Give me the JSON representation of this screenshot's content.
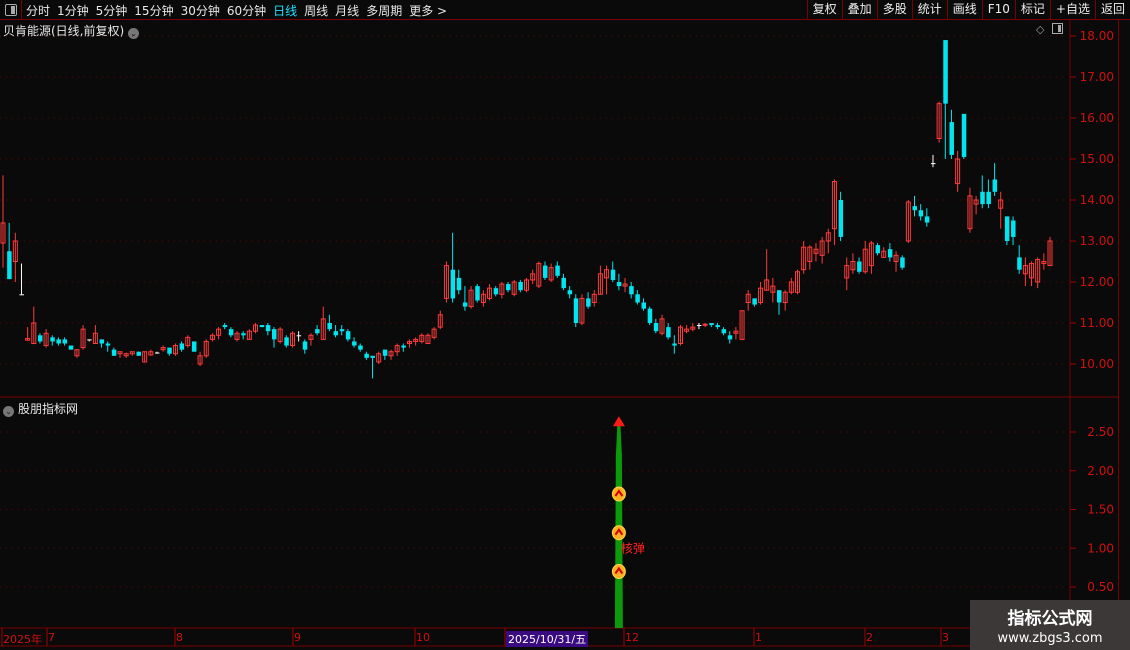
{
  "toolbar": {
    "periods": [
      "分时",
      "1分钟",
      "5分钟",
      "15分钟",
      "30分钟",
      "60分钟",
      "日线",
      "周线",
      "月线",
      "多周期",
      "更多 >"
    ],
    "active_period": "日线",
    "buttons": [
      "复权",
      "叠加",
      "多股",
      "统计",
      "画线",
      "F10",
      "标记",
      "+自选",
      "返回"
    ]
  },
  "main_panel": {
    "title": "贝肯能源(日线,前复权)",
    "y_ticks": [
      "18.00",
      "17.00",
      "16.00",
      "15.00",
      "14.00",
      "13.00",
      "12.00",
      "11.00",
      "10.00"
    ],
    "up_color": "#ff3b3b",
    "down_color": "#00e5f0",
    "flat_color": "#ffffff"
  },
  "indicator_panel": {
    "title": "股朋指标网",
    "y_ticks": [
      "2.50",
      "2.00",
      "1.50",
      "1.00",
      "0.50"
    ],
    "signal": {
      "bar": 101,
      "value": 2.6,
      "markers": [
        1.7,
        1.2,
        0.7
      ],
      "label": "核弹",
      "bar_color": "#0a9a0a",
      "arrow_color": "#ff1a1a"
    }
  },
  "time_axis": {
    "labels": [
      "2025年",
      "7",
      "8",
      "9",
      "10",
      "2025/10/31/五",
      "12",
      "1",
      "2",
      "3"
    ],
    "selected": "2025/10/31/五"
  },
  "watermark": {
    "name": "指标公式网",
    "url": "www.zbgs3.com"
  },
  "chart_data": {
    "type": "candlestick",
    "ylim": [
      9.6,
      18.0
    ],
    "indicator_ylim": [
      0,
      2.8
    ],
    "ohlc": [
      [
        12.95,
        14.6,
        12.35,
        13.44
      ],
      [
        12.75,
        13.44,
        12.07,
        12.07
      ],
      [
        12.5,
        13.2,
        12.0,
        13.0
      ],
      [
        11.7,
        12.45,
        11.7,
        11.7
      ],
      [
        10.58,
        10.9,
        10.58,
        10.62
      ],
      [
        10.5,
        11.4,
        10.5,
        11.0
      ],
      [
        10.7,
        10.75,
        10.5,
        10.55
      ],
      [
        10.45,
        10.85,
        10.4,
        10.75
      ],
      [
        10.65,
        10.7,
        10.45,
        10.55
      ],
      [
        10.6,
        10.65,
        10.45,
        10.5
      ],
      [
        10.6,
        10.65,
        10.45,
        10.5
      ],
      [
        10.45,
        10.45,
        10.35,
        10.35
      ],
      [
        10.2,
        10.35,
        10.15,
        10.35
      ],
      [
        10.4,
        10.95,
        10.35,
        10.85
      ],
      [
        10.6,
        10.6,
        10.55,
        10.6
      ],
      [
        10.5,
        10.95,
        10.5,
        10.75
      ],
      [
        10.6,
        10.6,
        10.4,
        10.5
      ],
      [
        10.5,
        10.55,
        10.3,
        10.45
      ],
      [
        10.35,
        10.4,
        10.2,
        10.2
      ],
      [
        10.25,
        10.3,
        10.15,
        10.3
      ],
      [
        10.2,
        10.28,
        10.15,
        10.25
      ],
      [
        10.25,
        10.3,
        10.2,
        10.3
      ],
      [
        10.3,
        10.3,
        10.2,
        10.2
      ],
      [
        10.05,
        10.3,
        10.05,
        10.3
      ],
      [
        10.22,
        10.35,
        10.2,
        10.3
      ],
      [
        10.28,
        10.3,
        10.25,
        10.28
      ],
      [
        10.35,
        10.45,
        10.3,
        10.4
      ],
      [
        10.4,
        10.4,
        10.2,
        10.25
      ],
      [
        10.25,
        10.5,
        10.2,
        10.45
      ],
      [
        10.5,
        10.55,
        10.3,
        10.35
      ],
      [
        10.45,
        10.7,
        10.4,
        10.65
      ],
      [
        10.55,
        10.55,
        10.3,
        10.3
      ],
      [
        10.0,
        10.3,
        9.95,
        10.2
      ],
      [
        10.2,
        10.6,
        10.15,
        10.55
      ],
      [
        10.6,
        10.75,
        10.55,
        10.7
      ],
      [
        10.7,
        10.9,
        10.6,
        10.85
      ],
      [
        10.95,
        11.0,
        10.85,
        10.9
      ],
      [
        10.85,
        10.9,
        10.65,
        10.7
      ],
      [
        10.6,
        10.8,
        10.55,
        10.75
      ],
      [
        10.75,
        10.8,
        10.6,
        10.7
      ],
      [
        10.6,
        10.85,
        10.6,
        10.8
      ],
      [
        10.8,
        11.0,
        10.75,
        10.95
      ],
      [
        10.95,
        10.95,
        10.9,
        10.9
      ],
      [
        10.95,
        11.0,
        10.7,
        10.8
      ],
      [
        10.85,
        10.9,
        10.4,
        10.6
      ],
      [
        10.55,
        10.9,
        10.5,
        10.85
      ],
      [
        10.65,
        10.7,
        10.4,
        10.45
      ],
      [
        10.45,
        10.8,
        10.4,
        10.75
      ],
      [
        10.7,
        10.8,
        10.55,
        10.7
      ],
      [
        10.55,
        10.6,
        10.25,
        10.35
      ],
      [
        10.6,
        10.75,
        10.45,
        10.7
      ],
      [
        10.85,
        10.95,
        10.7,
        10.75
      ],
      [
        10.6,
        11.4,
        10.6,
        11.1
      ],
      [
        11.0,
        11.2,
        10.8,
        10.85
      ],
      [
        10.8,
        10.95,
        10.65,
        10.7
      ],
      [
        10.85,
        10.95,
        10.7,
        10.8
      ],
      [
        10.8,
        10.85,
        10.55,
        10.6
      ],
      [
        10.55,
        10.65,
        10.4,
        10.45
      ],
      [
        10.45,
        10.5,
        10.3,
        10.35
      ],
      [
        10.25,
        10.3,
        10.1,
        10.15
      ],
      [
        10.2,
        10.2,
        9.65,
        10.15
      ],
      [
        10.05,
        10.3,
        10.0,
        10.25
      ],
      [
        10.35,
        10.35,
        10.1,
        10.2
      ],
      [
        10.2,
        10.35,
        10.1,
        10.3
      ],
      [
        10.3,
        10.5,
        10.2,
        10.45
      ],
      [
        10.45,
        10.5,
        10.3,
        10.4
      ],
      [
        10.5,
        10.6,
        10.4,
        10.55
      ],
      [
        10.55,
        10.65,
        10.45,
        10.6
      ],
      [
        10.55,
        10.75,
        10.5,
        10.7
      ],
      [
        10.5,
        10.75,
        10.5,
        10.7
      ],
      [
        10.65,
        10.9,
        10.6,
        10.85
      ],
      [
        10.9,
        11.3,
        10.85,
        11.2
      ],
      [
        11.6,
        12.5,
        11.5,
        12.4
      ],
      [
        12.3,
        13.2,
        11.5,
        11.6
      ],
      [
        12.1,
        12.3,
        11.7,
        11.8
      ],
      [
        11.5,
        11.9,
        11.3,
        11.4
      ],
      [
        11.4,
        11.9,
        11.35,
        11.8
      ],
      [
        11.9,
        11.95,
        11.5,
        11.55
      ],
      [
        11.5,
        11.8,
        11.4,
        11.7
      ],
      [
        11.6,
        11.95,
        11.55,
        11.85
      ],
      [
        11.85,
        11.9,
        11.65,
        11.7
      ],
      [
        11.7,
        12.0,
        11.6,
        11.95
      ],
      [
        11.95,
        12.0,
        11.75,
        11.8
      ],
      [
        11.7,
        12.05,
        11.65,
        12.0
      ],
      [
        12.0,
        12.05,
        11.75,
        11.8
      ],
      [
        11.8,
        12.1,
        11.75,
        12.05
      ],
      [
        12.05,
        12.3,
        11.95,
        12.2
      ],
      [
        11.9,
        12.5,
        11.85,
        12.45
      ],
      [
        12.4,
        12.5,
        12.05,
        12.1
      ],
      [
        12.05,
        12.45,
        12.0,
        12.35
      ],
      [
        12.4,
        12.5,
        12.1,
        12.15
      ],
      [
        12.1,
        12.2,
        11.8,
        11.85
      ],
      [
        11.8,
        11.9,
        11.6,
        11.7
      ],
      [
        11.6,
        11.7,
        10.9,
        11.0
      ],
      [
        11.0,
        11.7,
        10.95,
        11.6
      ],
      [
        11.6,
        11.75,
        11.35,
        11.4
      ],
      [
        11.5,
        11.8,
        11.4,
        11.7
      ],
      [
        11.7,
        12.4,
        11.7,
        12.2
      ],
      [
        12.1,
        12.4,
        11.7,
        12.3
      ],
      [
        12.3,
        12.5,
        12.0,
        12.05
      ],
      [
        12.0,
        12.2,
        11.8,
        11.9
      ],
      [
        11.9,
        12.1,
        11.75,
        11.95
      ],
      [
        11.9,
        12.0,
        11.6,
        11.7
      ],
      [
        11.7,
        11.8,
        11.45,
        11.5
      ],
      [
        11.5,
        11.6,
        11.3,
        11.35
      ],
      [
        11.35,
        11.4,
        10.95,
        11.0
      ],
      [
        11.0,
        11.1,
        10.75,
        10.8
      ],
      [
        10.75,
        11.2,
        10.7,
        11.1
      ],
      [
        10.9,
        11.0,
        10.6,
        10.65
      ],
      [
        10.5,
        10.7,
        10.25,
        10.45
      ],
      [
        10.5,
        10.95,
        10.45,
        10.9
      ],
      [
        10.8,
        10.95,
        10.75,
        10.85
      ],
      [
        10.85,
        11.0,
        10.8,
        10.9
      ],
      [
        10.95,
        11.0,
        10.85,
        10.95
      ],
      [
        10.95,
        11.0,
        10.9,
        10.97
      ],
      [
        11.0,
        11.0,
        10.9,
        10.95
      ],
      [
        10.95,
        11.0,
        10.85,
        10.9
      ],
      [
        10.85,
        10.9,
        10.7,
        10.75
      ],
      [
        10.7,
        10.8,
        10.5,
        10.6
      ],
      [
        10.75,
        10.9,
        10.6,
        10.8
      ],
      [
        10.6,
        11.3,
        10.6,
        11.3
      ],
      [
        11.5,
        11.8,
        11.3,
        11.7
      ],
      [
        11.6,
        11.6,
        11.4,
        11.45
      ],
      [
        11.5,
        12.0,
        11.45,
        11.85
      ],
      [
        11.8,
        12.8,
        11.8,
        12.05
      ],
      [
        11.75,
        12.1,
        11.5,
        11.9
      ],
      [
        11.8,
        11.8,
        11.2,
        11.5
      ],
      [
        11.5,
        11.8,
        11.3,
        11.75
      ],
      [
        11.75,
        12.1,
        11.7,
        12.0
      ],
      [
        11.75,
        12.3,
        11.7,
        12.25
      ],
      [
        12.3,
        13.0,
        12.2,
        12.85
      ],
      [
        12.5,
        12.9,
        12.3,
        12.85
      ],
      [
        12.7,
        12.95,
        12.5,
        12.8
      ],
      [
        12.65,
        13.1,
        12.45,
        13.0
      ],
      [
        13.0,
        13.3,
        12.7,
        13.2
      ],
      [
        13.3,
        14.5,
        12.9,
        14.45
      ],
      [
        14.0,
        14.2,
        13.0,
        13.1
      ],
      [
        12.1,
        12.6,
        11.8,
        12.4
      ],
      [
        12.3,
        12.7,
        12.2,
        12.5
      ],
      [
        12.5,
        12.6,
        12.2,
        12.25
      ],
      [
        12.25,
        13.0,
        12.2,
        12.8
      ],
      [
        12.4,
        13.0,
        12.2,
        12.95
      ],
      [
        12.9,
        12.95,
        12.65,
        12.7
      ],
      [
        12.6,
        12.85,
        12.6,
        12.75
      ],
      [
        12.8,
        12.95,
        12.5,
        12.6
      ],
      [
        12.5,
        12.75,
        12.25,
        12.65
      ],
      [
        12.6,
        12.65,
        12.3,
        12.35
      ],
      [
        13.0,
        14.0,
        12.95,
        13.95
      ],
      [
        13.85,
        14.1,
        13.6,
        13.75
      ],
      [
        13.75,
        13.9,
        13.5,
        13.6
      ],
      [
        13.6,
        13.8,
        13.35,
        13.45
      ],
      [
        14.9,
        15.1,
        14.8,
        14.9
      ],
      [
        15.5,
        16.4,
        15.4,
        16.35
      ],
      [
        17.9,
        17.9,
        15.0,
        16.35
      ],
      [
        15.9,
        16.2,
        15.0,
        15.1
      ],
      [
        14.4,
        15.2,
        14.2,
        15.0
      ],
      [
        16.1,
        16.1,
        15.0,
        15.05
      ],
      [
        13.3,
        14.3,
        13.2,
        14.1
      ],
      [
        13.9,
        14.1,
        13.65,
        14.0
      ],
      [
        14.2,
        14.6,
        13.8,
        13.9
      ],
      [
        14.2,
        14.5,
        13.8,
        13.9
      ],
      [
        14.5,
        14.9,
        14.1,
        14.2
      ],
      [
        13.8,
        14.2,
        13.3,
        14.0
      ],
      [
        13.6,
        13.6,
        12.9,
        13.0
      ],
      [
        13.5,
        13.6,
        12.9,
        13.1
      ],
      [
        12.6,
        12.9,
        12.2,
        12.3
      ],
      [
        12.2,
        12.6,
        11.9,
        12.4
      ],
      [
        12.1,
        12.5,
        11.9,
        12.45
      ],
      [
        12.0,
        12.6,
        11.85,
        12.55
      ],
      [
        12.45,
        12.7,
        12.3,
        12.5
      ],
      [
        12.4,
        13.1,
        12.4,
        13.0
      ]
    ]
  }
}
